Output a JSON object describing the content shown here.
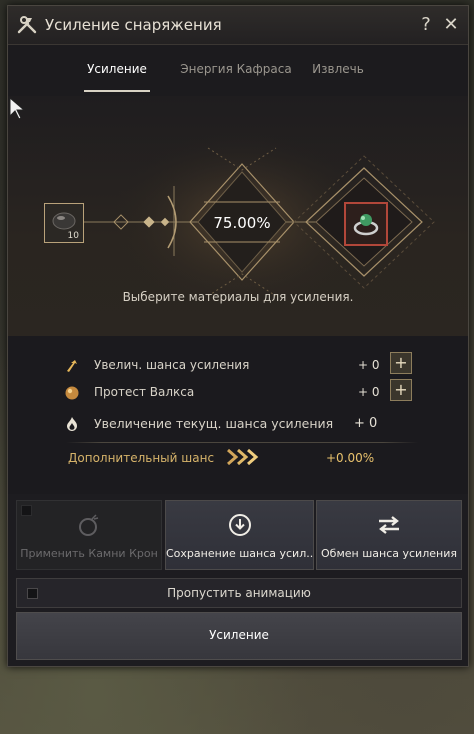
{
  "window": {
    "title": "Усиление снаряжения",
    "help_label": "?",
    "close_label": "✕"
  },
  "tabs": [
    {
      "label": "Усиление",
      "active": true
    },
    {
      "label": "Энергия Кафраса",
      "active": false
    },
    {
      "label": "Извлечь",
      "active": false
    }
  ],
  "enhance": {
    "material_count": "10",
    "chance": "75.00%",
    "hint": "Выберите материалы для усиления."
  },
  "stats": [
    {
      "label": "Увелич. шанса усиления",
      "value": "+ 0",
      "icon": "arrow-up-icon",
      "has_plus": true
    },
    {
      "label": "Протест Валкса",
      "value": "+ 0",
      "icon": "valks-orb-icon",
      "has_plus": true
    },
    {
      "label": "Увеличение текущ. шанса усиления",
      "value": "+ 0",
      "icon": "flame-icon",
      "has_plus": false
    }
  ],
  "extra": {
    "label": "Дополнительный шанс",
    "value": "+0.00%"
  },
  "actions": [
    {
      "label": "Применить Камни Крон",
      "icon": "cron-stone-icon",
      "enabled": false
    },
    {
      "label": "Сохранение шанса усил...",
      "icon": "save-down-icon",
      "enabled": true
    },
    {
      "label": "Обмен шанса усиления",
      "icon": "swap-arrows-icon",
      "enabled": true
    }
  ],
  "skip_animation": {
    "label": "Пропустить анимацию",
    "checked": false
  },
  "enhance_button": {
    "label": "Усиление"
  },
  "colors": {
    "accent_gold": "#d6b36a",
    "frame_gold": "#b9a27a",
    "selected_red": "#b2473a"
  }
}
